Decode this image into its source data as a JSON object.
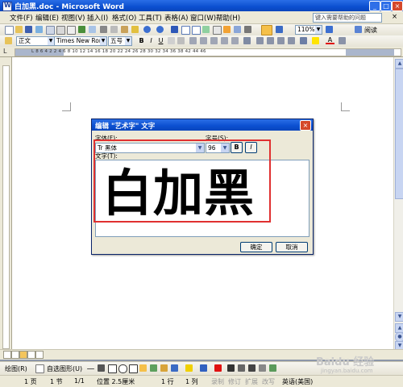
{
  "window": {
    "title": "白加黑.doc - Microsoft Word",
    "min": "_",
    "max": "□",
    "close": "×"
  },
  "menu": {
    "items": [
      "文件(F)",
      "编辑(E)",
      "视图(V)",
      "插入(I)",
      "格式(O)",
      "工具(T)",
      "表格(A)",
      "窗口(W)",
      "帮助(H)"
    ],
    "help_placeholder": "键入需要帮助的问题",
    "close": "×"
  },
  "toolbar": {
    "zoom": "110%",
    "read_label": "阅读",
    "style": "正文",
    "font": "Times New Roman",
    "size": "五号",
    "bold": "B",
    "italic": "I",
    "underline": "U",
    "font_color_label": "A"
  },
  "ruler": {
    "text": "L  8 6 4 2  2 4 6 8 10 12 14 16 18 20 22 24 26 28 30 32 34 36 38  42 44 46"
  },
  "dialog": {
    "title": "编辑 \"艺术字\" 文字",
    "close": "×",
    "font_label": "字体(F):",
    "font_value": "Tr 黑体",
    "size_label": "字号(S):",
    "size_value": "96",
    "bold": "B",
    "italic": "I",
    "text_label": "文字(T):",
    "text_value": "白加黑",
    "ok": "确定",
    "cancel": "取消"
  },
  "drawbar": {
    "draw_label": "绘图(R)",
    "autoshape_label": "自选图形(U)"
  },
  "status": {
    "page": "1 页",
    "section": "1 节",
    "page_of": "1/1",
    "position": "位置 2.5厘米",
    "line": "1 行",
    "column": "1 列",
    "rec": "录制",
    "trk": "修订",
    "ext": "扩展",
    "ovr": "改写",
    "language": "英语(美国)"
  },
  "watermark": {
    "brand": "Baidu 经验",
    "url": "jingyan.baidu.com"
  },
  "colors": {
    "titlebar": "#0b4fd0",
    "highlight": "#e03030",
    "chrome": "#ece9d8"
  }
}
